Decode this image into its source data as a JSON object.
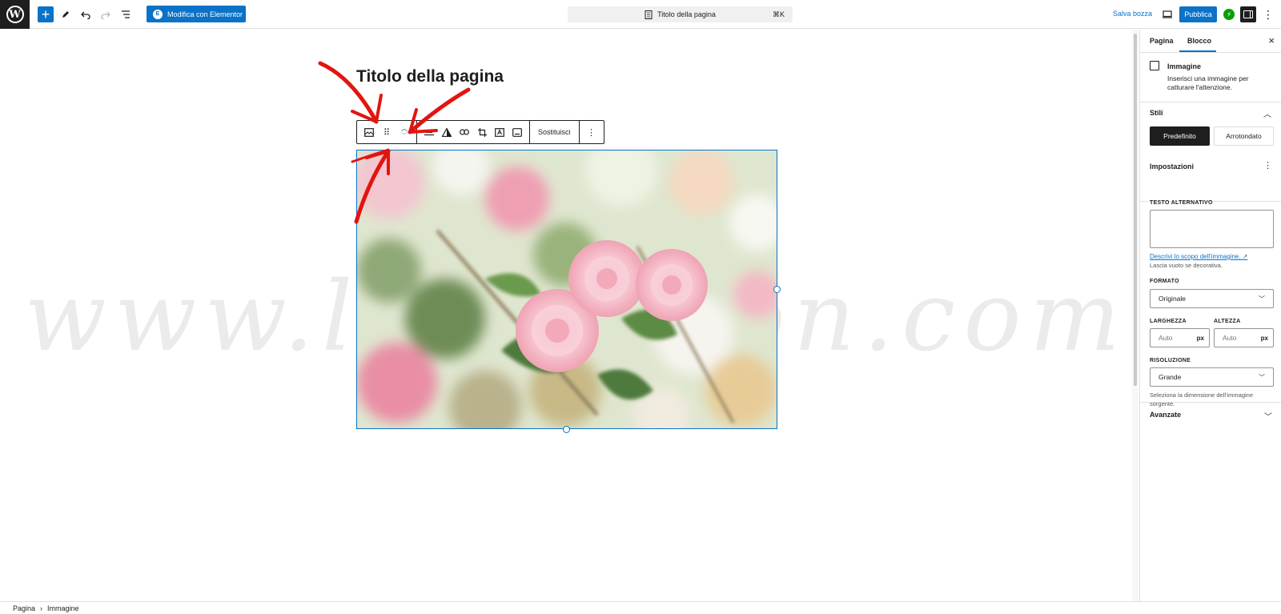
{
  "topbar": {
    "elementor_label": "Modifica con Elementor",
    "document_title": "Titolo della pagina",
    "shortcut": "⌘K",
    "save_draft": "Salva bozza",
    "publish": "Pubblica"
  },
  "watermark": "www.l...rcobon.com",
  "editor": {
    "page_title": "Titolo della pagina",
    "toolbar": {
      "replace_label": "Sostituisci"
    }
  },
  "sidebar": {
    "tabs": [
      "Pagina",
      "Blocco"
    ],
    "block": {
      "title": "Immagine",
      "description": "Inserisci una immagine per catturare l'attenzione."
    },
    "styles": {
      "heading": "Stili",
      "options": [
        "Predefinito",
        "Arrotondato"
      ],
      "selected": "Predefinito"
    },
    "settings": {
      "heading": "Impostazioni",
      "alt_label": "TESTO ALTERNATIVO",
      "alt_value": "",
      "alt_link": "Descrivi lo scopo dell'immagine. ↗",
      "alt_help": "Lascia vuoto se decorativa.",
      "format_label": "FORMATO",
      "format_value": "Originale",
      "width_label": "LARGHEZZA",
      "width_value": "Auto",
      "height_label": "ALTEZZA",
      "height_value": "Auto",
      "unit": "px",
      "resolution_label": "RISOLUZIONE",
      "resolution_value": "Grande",
      "resolution_help": "Seleziona la dimensione dell'immagine sorgente."
    },
    "advanced": "Avanzate"
  },
  "footer": {
    "crumbs": [
      "Pagina",
      "Immagine"
    ]
  },
  "colors": {
    "accent": "#0a72c7",
    "dark": "#1e1e1e",
    "annotation": "#e3140f"
  }
}
